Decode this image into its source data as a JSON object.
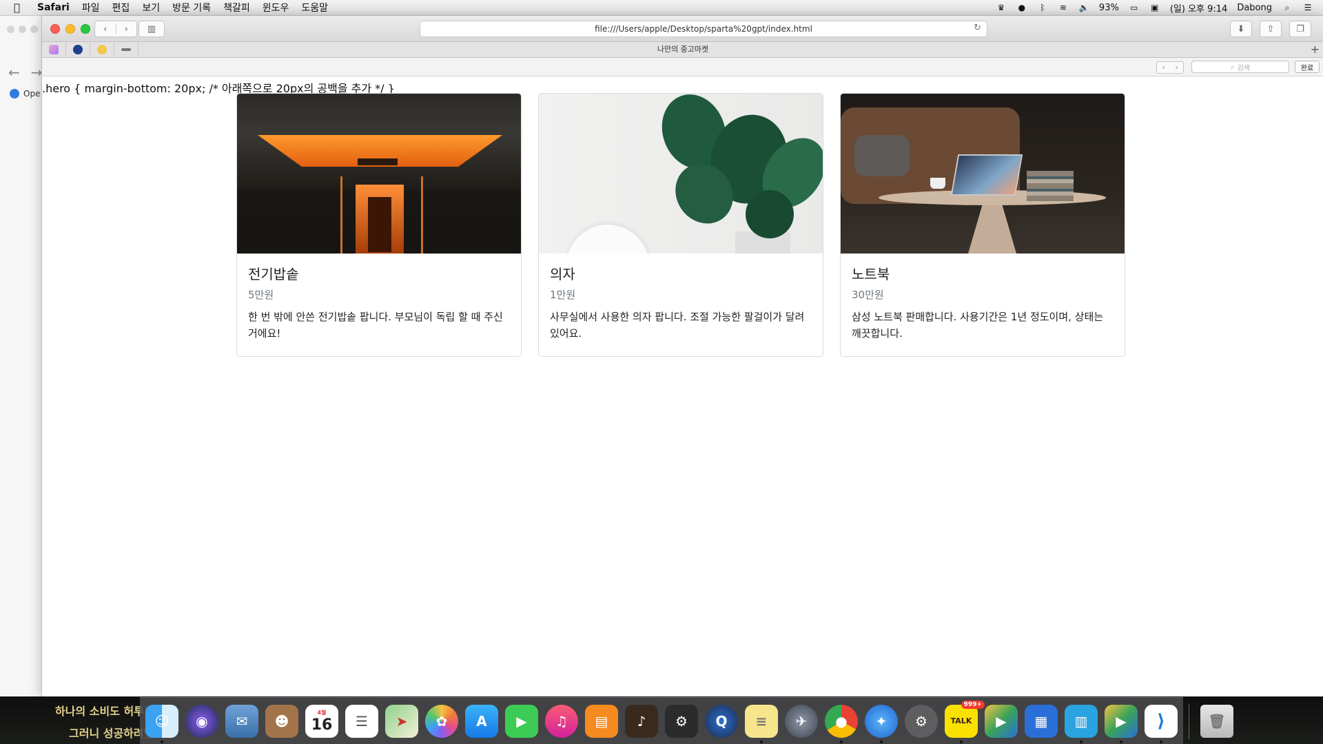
{
  "menubar": {
    "app_name": "Safari",
    "menus": [
      "파일",
      "편집",
      "보기",
      "방문 기록",
      "책갈피",
      "윈도우",
      "도움말"
    ],
    "battery": "93%",
    "datetime": "(일) 오후 9:14",
    "user": "Dabong"
  },
  "bg_window": {
    "label": "Ope"
  },
  "browser": {
    "url": "file:///Users/apple/Desktop/sparta%20gpt/index.html",
    "tab_title": "나만의 중고마켓",
    "find_placeholder": "검색",
    "find_done": "완료"
  },
  "page": {
    "css_text": ".hero { margin-bottom: 20px; /* 아래쪽으로 20px의 공백을 추가 */ }",
    "cards": [
      {
        "title": "전기밥솥",
        "price": "5만원",
        "desc": "한 번 밖에 안쓴 전기밥솥 팝니다. 부모님이 독립 할 때 주신 거에요!"
      },
      {
        "title": "의자",
        "price": "1만원",
        "desc": "사무실에서 사용한 의자 팝니다. 조절 가능한 팔걸이가 달려있어요."
      },
      {
        "title": "노트북",
        "price": "30만원",
        "desc": "삼성 노트북 판매합니다. 사용기간은 1년 정도이며, 상태는 깨끗합니다."
      }
    ]
  },
  "desktop": {
    "line1": "하나의 소비도 허투로",
    "line2": "그러니 성공하려면"
  },
  "dock": {
    "calendar_day": "16",
    "calendar_month": "4월",
    "talk_label": "TALK",
    "talk_badge": "999+",
    "icons": [
      "finder-icon",
      "siri-icon",
      "mail-icon",
      "contacts-icon",
      "calendar-icon",
      "reminders-icon",
      "maps-icon",
      "photos-icon",
      "app-store-icon",
      "facetime-icon",
      "music-icon",
      "books-icon",
      "garageband-icon",
      "keychain-icon",
      "quicktime-icon",
      "notes-icon",
      "launchpad-icon",
      "chrome-icon",
      "safari-icon",
      "system-preferences-icon",
      "kakaotalk-icon",
      "office-icon",
      "word-icon",
      "excel-icon",
      "vscode-icon",
      "trash-icon"
    ]
  }
}
